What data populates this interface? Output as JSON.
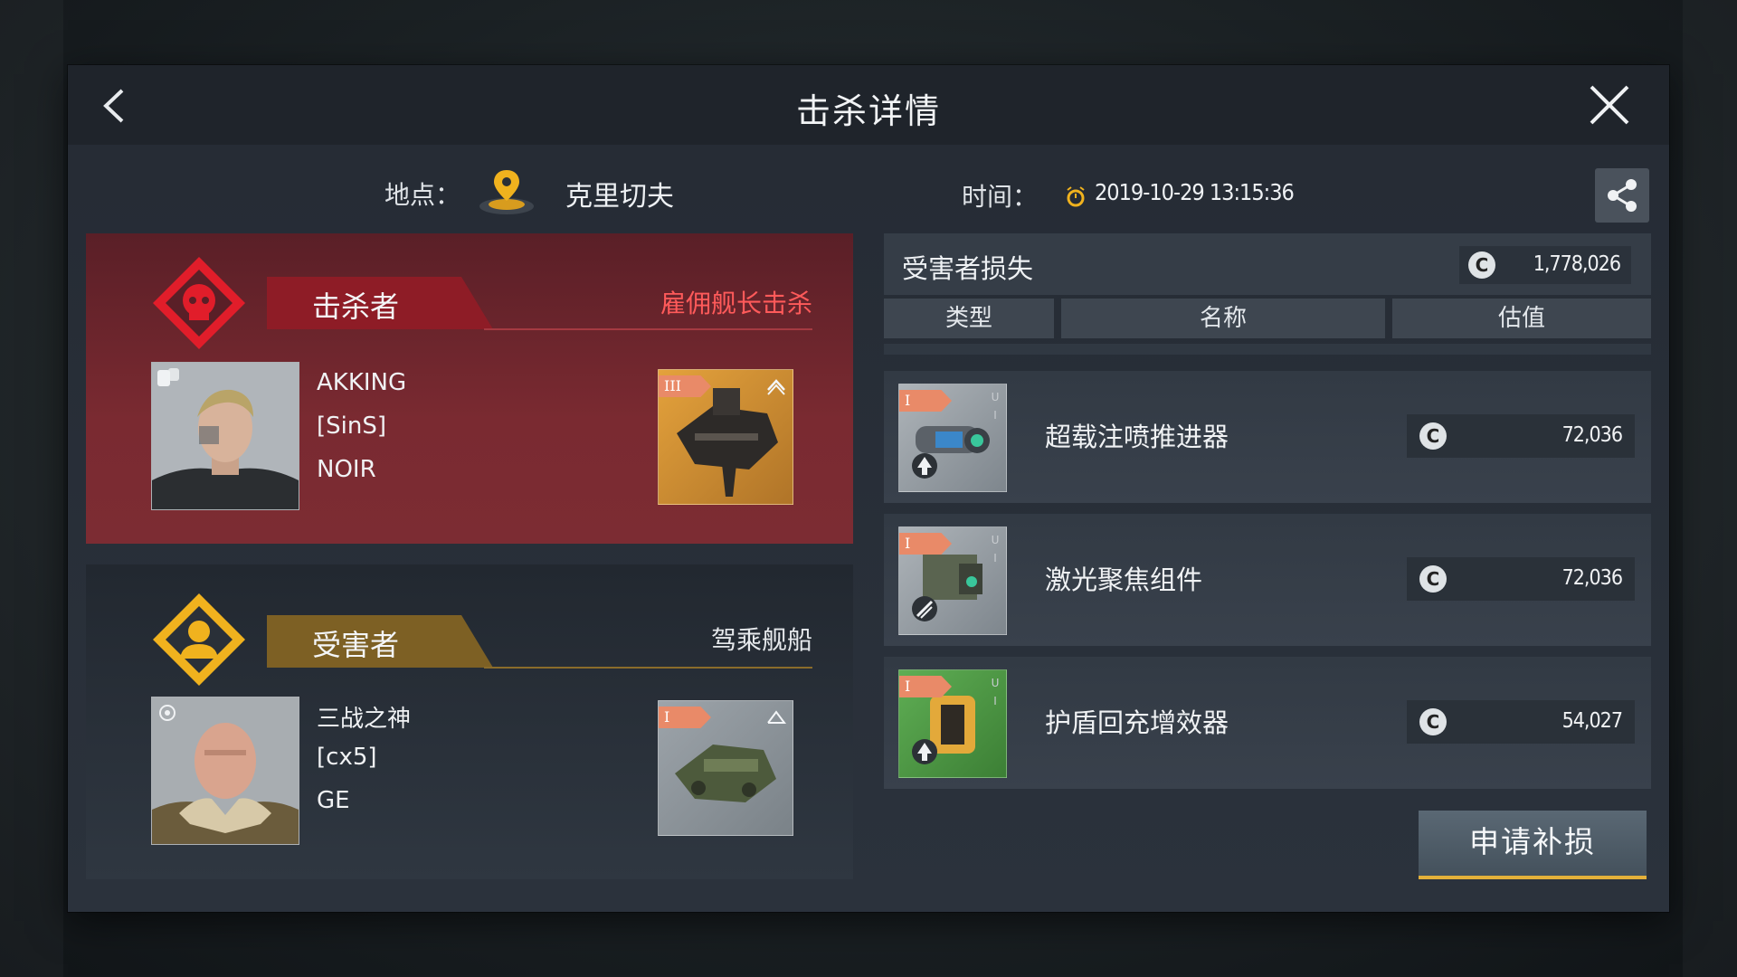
{
  "header": {
    "title": "击杀详情"
  },
  "info": {
    "location_label": "地点：",
    "location_value": "克里切夫",
    "time_label": "时间：",
    "time_value": "2019-10-29 13:15:36"
  },
  "killer": {
    "section_label": "击杀者",
    "note": "雇佣舰长击杀",
    "name": "AKKING",
    "corp": "[SinS]",
    "alliance": "NOIR",
    "ship_tier": "III"
  },
  "victim": {
    "section_label": "受害者",
    "note": "驾乘舰船",
    "name": "三战之神",
    "corp": "[cx5]",
    "alliance": "GE",
    "ship_tier": "I"
  },
  "loss": {
    "title": "受害者损失",
    "total_value": "1,778,026",
    "currency_symbol": "C",
    "columns": [
      "类型",
      "名称",
      "估值"
    ],
    "items": [
      {
        "tier": "I",
        "name": "超载注喷推进器",
        "value": "72,036",
        "icon": "afterburner-module-icon",
        "slot_marks": [
          "U",
          "I"
        ]
      },
      {
        "tier": "I",
        "name": "激光聚焦组件",
        "value": "72,036",
        "icon": "laser-focus-module-icon",
        "slot_marks": [
          "U",
          "I"
        ]
      },
      {
        "tier": "I",
        "name": "护盾回充增效器",
        "value": "54,027",
        "icon": "shield-recharger-module-icon",
        "slot_marks": [
          "U",
          "I"
        ]
      }
    ]
  },
  "actions": {
    "claim_label": "申请补损"
  },
  "colors": {
    "killer_red": "#7a2a31",
    "victim_gold": "#e9a61a",
    "accent_yellow": "#e4b13a"
  }
}
